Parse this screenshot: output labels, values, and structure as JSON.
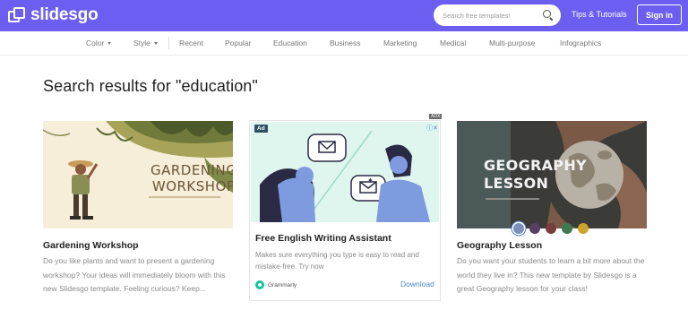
{
  "header": {
    "logo_text": "slidesgo",
    "search_placeholder": "Search free templates!",
    "tips_label": "Tips & Tutorials",
    "signin_label": "Sign in",
    "bar_color": "#6b5ef0"
  },
  "nav": {
    "filters": [
      {
        "label": "Color",
        "has_caret": true
      },
      {
        "label": "Style",
        "has_caret": true
      }
    ],
    "categories": [
      "Recent",
      "Popular",
      "Education",
      "Business",
      "Marketing",
      "Medical",
      "Multi-purpose",
      "Infographics"
    ]
  },
  "page_title": "Search results for \"education\"",
  "cards": [
    {
      "title": "Gardening Workshop",
      "thumb_text": [
        "GARDENING",
        "WORKSHOP"
      ],
      "description": "Do you like plants and want to present a gardening workshop? Your ideas will immediately bloom with this new Slidesgo template. Feeling curious? Keep..."
    },
    {
      "title": "Geography Lesson",
      "thumb_text": [
        "GEOGRAPHY",
        "LESSON"
      ],
      "description": "Do you want your students to learn a bit more about the world they live in? This new template by Slidesgo is a great Geography lesson for your class!",
      "swatches": [
        "#7b8fb8",
        "#5a3f64",
        "#7a3d3d",
        "#3f7a4e",
        "#c9a62b"
      ],
      "selected_swatch": 0
    }
  ],
  "ad": {
    "badge": "Ad",
    "corner_label": "ADX",
    "controls": "ⓘ✕",
    "title": "Free English Writing Assistant",
    "description": "Makes sure everything you type is easy to read and mistake-free. Try now",
    "brand": "Grammarly",
    "cta": "Download"
  }
}
